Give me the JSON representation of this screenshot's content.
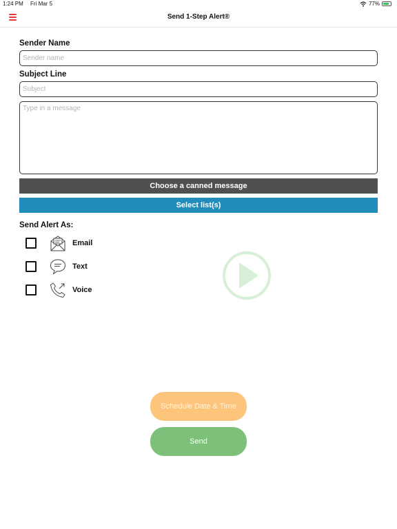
{
  "status_bar": {
    "time": "1:24 PM",
    "date": "Fri Mar 5",
    "battery": "77%",
    "battery_level": 0.77
  },
  "header": {
    "title": "Send 1-Step Alert®",
    "menu_icon": "hamburger-menu-icon"
  },
  "form": {
    "sender_label": "Sender Name",
    "sender_placeholder": "Sender name",
    "sender_value": "",
    "subject_label": "Subject Line",
    "subject_placeholder": "Subject",
    "subject_value": "",
    "message_placeholder": "Type in a message",
    "message_value": ""
  },
  "buttons": {
    "canned": "Choose a canned message",
    "lists": "Select list(s)",
    "schedule": "Schedule Date & Time",
    "send": "Send"
  },
  "send_as": {
    "label": "Send Alert As:",
    "options": [
      {
        "label": "Email",
        "icon": "envelope-icon",
        "checked": false
      },
      {
        "label": "Text",
        "icon": "chat-bubble-icon",
        "checked": false
      },
      {
        "label": "Voice",
        "icon": "phone-icon",
        "checked": false
      }
    ]
  },
  "colors": {
    "menu": "#e53935",
    "canned_bg": "#505050",
    "lists_bg": "#218dba",
    "schedule_bg": "#fdc47c",
    "send_bg": "#7dc07a",
    "play": "#d6efd6"
  }
}
